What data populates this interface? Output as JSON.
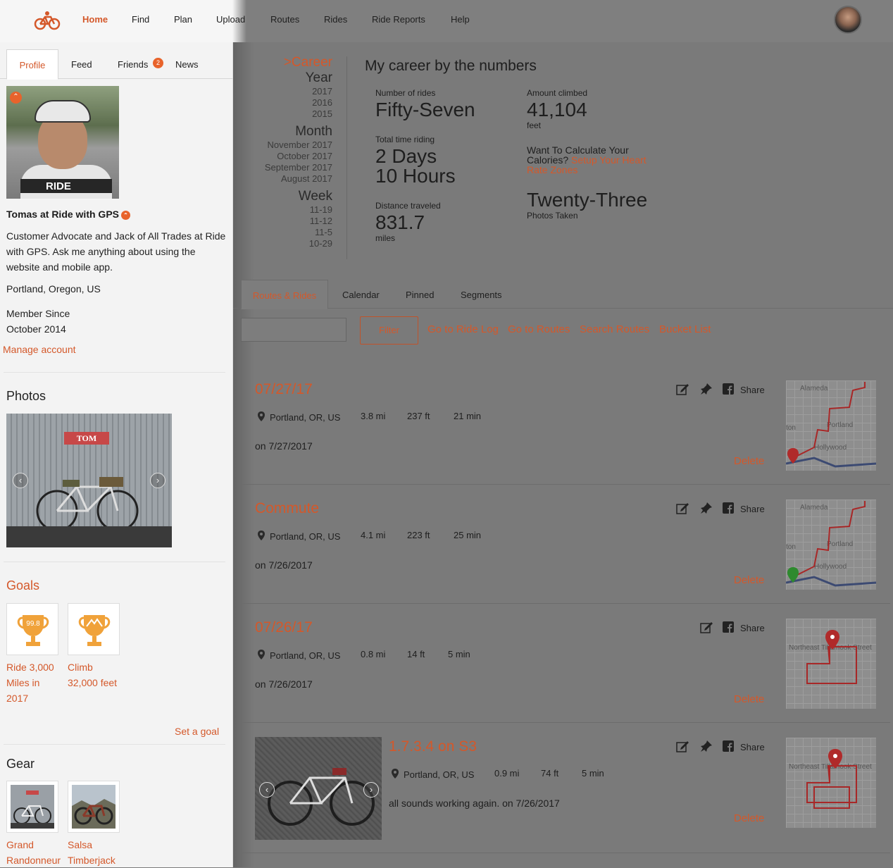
{
  "nav": {
    "items": [
      "Home",
      "Find",
      "Plan",
      "Upload",
      "Routes",
      "Rides",
      "Ride Reports",
      "Help"
    ],
    "active": "Home"
  },
  "sidebar": {
    "tabs": [
      "Profile",
      "Feed",
      "Friends",
      "News"
    ],
    "friends_badge": "2",
    "name": "Tomas at Ride with GPS",
    "bio": "Customer Advocate and Jack of All Trades at Ride with GPS. Ask me anything about using the website and mobile app.",
    "location": "Portland, Oregon, US",
    "member_since_label": "Member Since",
    "member_since_date": "October 2014",
    "manage_account": "Manage account",
    "photos_title": "Photos",
    "photo_sign": "TOM",
    "goals_title": "Goals",
    "goals": [
      {
        "label": "Ride 3,000 Miles in 2017",
        "trophy_text": "99.8"
      },
      {
        "label": "Climb 32,000 feet",
        "trophy_text": ""
      }
    ],
    "set_goal": "Set a goal",
    "gear_title": "Gear",
    "gear": [
      {
        "label": "Grand Randonneur"
      },
      {
        "label": "Salsa Timberjack"
      }
    ],
    "photo_ride_text": "RIDE"
  },
  "career_nav": {
    "career": ">Career",
    "year_head": "Year",
    "years": [
      "2017",
      "2016",
      "2015"
    ],
    "month_head": "Month",
    "months": [
      "November 2017",
      "October 2017",
      "September 2017",
      "August 2017"
    ],
    "week_head": "Week",
    "weeks": [
      "11-19",
      "11-12",
      "11-5",
      "10-29"
    ]
  },
  "career": {
    "title": "My career by the numbers",
    "rides_label": "Number of rides",
    "rides_value": "Fifty-Seven",
    "time_label": "Total time riding",
    "time_value_1": "2 Days",
    "time_value_2": "10 Hours",
    "distance_label": "Distance traveled",
    "distance_value": "831.7",
    "distance_unit": "miles",
    "climbed_label": "Amount climbed",
    "climbed_value": "41,104",
    "climbed_unit": "feet",
    "calories_text": "Want To Calculate Your Calories? ",
    "calories_link": "Setup Your Heart Rate Zones",
    "photos_value": "Twenty-Three",
    "photos_label": "Photos Taken"
  },
  "main_tabs": [
    "Routes & Rides",
    "Calendar",
    "Pinned",
    "Segments"
  ],
  "filter": {
    "button": "Filter",
    "links": [
      "Go to Ride Log",
      "Go to Routes",
      "Search Routes",
      "Bucket List"
    ]
  },
  "rides": [
    {
      "title": "07/27/17",
      "location": "Portland, OR, US",
      "distance": "3.8 mi",
      "elevation": "237 ft",
      "duration": "21 min",
      "desc": "on 7/27/2017",
      "delete": "Delete",
      "share": "Share",
      "map_labels": [
        "Alameda",
        "Portland",
        "Hollywood",
        "ton"
      ]
    },
    {
      "title": "Commute",
      "location": "Portland, OR, US",
      "distance": "4.1 mi",
      "elevation": "223 ft",
      "duration": "25 min",
      "desc": "on 7/26/2017",
      "delete": "Delete",
      "share": "Share",
      "map_labels": [
        "Alameda",
        "Portland",
        "Hollywood",
        "ton"
      ]
    },
    {
      "title": "07/26/17",
      "location": "Portland, OR, US",
      "distance": "0.8 mi",
      "elevation": "14 ft",
      "duration": "5 min",
      "desc": "on 7/26/2017",
      "delete": "Delete",
      "share": "Share",
      "map_labels": [
        "Northeast Tillamook Street"
      ]
    },
    {
      "title": "1.7.3.4 on S3",
      "location": "Portland, OR, US",
      "distance": "0.9 mi",
      "elevation": "74 ft",
      "duration": "5 min",
      "desc": "all sounds working again. on 7/26/2017",
      "delete": "Delete",
      "share": "Share",
      "map_labels": [
        "Northeast Tillamook Street"
      ]
    }
  ],
  "colors": {
    "accent": "#d4582a",
    "overlay": "#7a7a7a",
    "sidebar": "#f3f3f3"
  }
}
